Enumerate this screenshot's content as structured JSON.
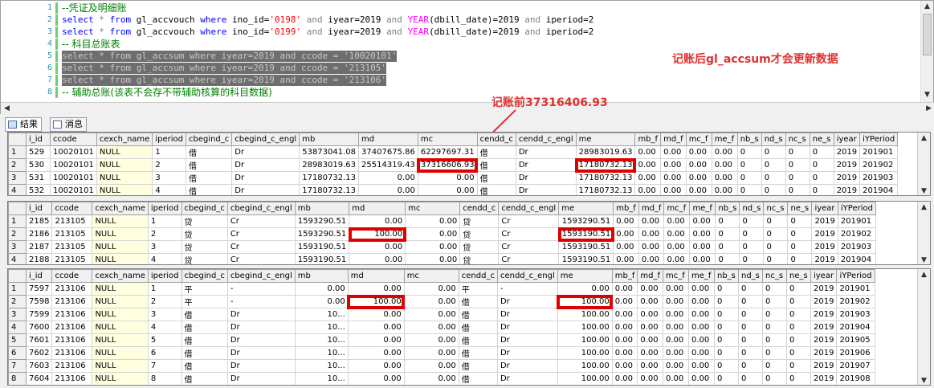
{
  "editor": {
    "lines": [
      {
        "n": "1",
        "parts": [
          {
            "t": "--凭证及明细账",
            "c": "cmt"
          }
        ]
      },
      {
        "n": "2",
        "parts": [
          {
            "t": "select",
            "c": "kw"
          },
          {
            "t": " * ",
            "c": "gray"
          },
          {
            "t": "from",
            "c": "kw"
          },
          {
            "t": " gl_accvouch ",
            "c": ""
          },
          {
            "t": "where",
            "c": "kw"
          },
          {
            "t": " ino_id=",
            "c": ""
          },
          {
            "t": "'0198'",
            "c": "str"
          },
          {
            "t": " and ",
            "c": "gray"
          },
          {
            "t": "iyear=2019 ",
            "c": ""
          },
          {
            "t": "and",
            "c": "gray"
          },
          {
            "t": " ",
            "c": ""
          },
          {
            "t": "YEAR",
            "c": "fn"
          },
          {
            "t": "(dbill_date)=2019 ",
            "c": ""
          },
          {
            "t": "and",
            "c": "gray"
          },
          {
            "t": " iperiod=2",
            "c": ""
          }
        ]
      },
      {
        "n": "3",
        "parts": [
          {
            "t": "select",
            "c": "kw"
          },
          {
            "t": " * ",
            "c": "gray"
          },
          {
            "t": "from",
            "c": "kw"
          },
          {
            "t": " gl_accvouch ",
            "c": ""
          },
          {
            "t": "where",
            "c": "kw"
          },
          {
            "t": " ino_id=",
            "c": ""
          },
          {
            "t": "'0199'",
            "c": "str"
          },
          {
            "t": " and ",
            "c": "gray"
          },
          {
            "t": "iyear=2019 ",
            "c": ""
          },
          {
            "t": "and",
            "c": "gray"
          },
          {
            "t": " ",
            "c": ""
          },
          {
            "t": "YEAR",
            "c": "fn"
          },
          {
            "t": "(dbill_date)=2019 ",
            "c": ""
          },
          {
            "t": "and",
            "c": "gray"
          },
          {
            "t": " iperiod=2",
            "c": ""
          }
        ]
      },
      {
        "n": "4",
        "parts": [
          {
            "t": "-- 科目总账表",
            "c": "cmt"
          }
        ]
      },
      {
        "n": "5",
        "sel": true,
        "parts": [
          {
            "t": "select * from gl_accsum where iyear=2019 and ccode = ",
            "c": ""
          },
          {
            "t": "'10020101'",
            "c": "str"
          }
        ]
      },
      {
        "n": "6",
        "sel": true,
        "parts": [
          {
            "t": "select * from gl_accsum where iyear=2019 and ccode = ",
            "c": ""
          },
          {
            "t": "'213105'",
            "c": "str"
          }
        ]
      },
      {
        "n": "7",
        "sel": true,
        "parts": [
          {
            "t": "select * from gl_accsum where iyear=2019 and ccode = ",
            "c": ""
          },
          {
            "t": "'213106'",
            "c": "str"
          }
        ]
      },
      {
        "n": "8",
        "parts": [
          {
            "t": "-- 辅助总账(该表不会存不带辅助核算的科目数据)",
            "c": "cmt"
          }
        ]
      }
    ]
  },
  "annotations": {
    "note_after": "记账后gl_accsum才会更新数据",
    "note_before": "记账前37316406.93"
  },
  "tabs": {
    "results": "结果",
    "messages": "消息"
  },
  "grid1": {
    "columns": [
      "",
      "i_id",
      "ccode",
      "cexch_name",
      "iperiod",
      "cbegind_c",
      "cbegind_c_engl",
      "mb",
      "md",
      "mc",
      "cendd_c",
      "cendd_c_engl",
      "me",
      "mb_f",
      "md_f",
      "mc_f",
      "me_f",
      "nb_s",
      "nd_s",
      "nc_s",
      "ne_s",
      "iyear",
      "iYPeriod"
    ],
    "rows": [
      [
        "1",
        "529",
        "10020101",
        "NULL",
        "1",
        "借",
        "Dr",
        "53873041.08",
        "37407675.86",
        "62297697.31",
        "借",
        "Dr",
        "28983019.63",
        "0.00",
        "0.00",
        "0.00",
        "0.00",
        "0",
        "0",
        "0",
        "0",
        "2019",
        "201901"
      ],
      [
        "2",
        "530",
        "10020101",
        "NULL",
        "2",
        "借",
        "Dr",
        "28983019.63",
        "25514319.43",
        "37316606.93",
        "借",
        "Dr",
        "17180732.13",
        "0.00",
        "0.00",
        "0.00",
        "0.00",
        "0",
        "0",
        "0",
        "0",
        "2019",
        "201902"
      ],
      [
        "3",
        "531",
        "10020101",
        "NULL",
        "3",
        "借",
        "Dr",
        "17180732.13",
        "0.00",
        "0.00",
        "借",
        "Dr",
        "17180732.13",
        "0.00",
        "0.00",
        "0.00",
        "0.00",
        "0",
        "0",
        "0",
        "0",
        "2019",
        "201903"
      ],
      [
        "4",
        "532",
        "10020101",
        "NULL",
        "4",
        "借",
        "Dr",
        "17180732.13",
        "0.00",
        "0.00",
        "借",
        "Dr",
        "17180732.13",
        "0.00",
        "0.00",
        "0.00",
        "0.00",
        "0",
        "0",
        "0",
        "0",
        "2019",
        "201904"
      ]
    ]
  },
  "grid2": {
    "columns": [
      "",
      "i_id",
      "ccode",
      "cexch_name",
      "iperiod",
      "cbegind_c",
      "cbegind_c_engl",
      "mb",
      "md",
      "mc",
      "cendd_c",
      "cendd_c_engl",
      "me",
      "mb_f",
      "md_f",
      "mc_f",
      "me_f",
      "nb_s",
      "nd_s",
      "nc_s",
      "ne_s",
      "iyear",
      "iYPeriod"
    ],
    "rows": [
      [
        "1",
        "2185",
        "213105",
        "NULL",
        "1",
        "贷",
        "Cr",
        "1593290.51",
        "0.00",
        "0.00",
        "贷",
        "Cr",
        "1593290.51",
        "0.00",
        "0.00",
        "0.00",
        "0.00",
        "0",
        "0",
        "0",
        "0",
        "2019",
        "201901"
      ],
      [
        "2",
        "2186",
        "213105",
        "NULL",
        "2",
        "贷",
        "Cr",
        "1593290.51",
        "100.00",
        "0.00",
        "贷",
        "Cr",
        "1593190.51",
        "0.00",
        "0.00",
        "0.00",
        "0.00",
        "0",
        "0",
        "0",
        "0",
        "2019",
        "201902"
      ],
      [
        "3",
        "2187",
        "213105",
        "NULL",
        "3",
        "贷",
        "Cr",
        "1593190.51",
        "0.00",
        "0.00",
        "贷",
        "Cr",
        "1593190.51",
        "0.00",
        "0.00",
        "0.00",
        "0.00",
        "0",
        "0",
        "0",
        "0",
        "2019",
        "201903"
      ],
      [
        "4",
        "2188",
        "213105",
        "NULL",
        "4",
        "贷",
        "Cr",
        "1593190.51",
        "0.00",
        "0.00",
        "贷",
        "Cr",
        "1593190.51",
        "0.00",
        "0.00",
        "0.00",
        "0.00",
        "0",
        "0",
        "0",
        "0",
        "2019",
        "201904"
      ]
    ]
  },
  "grid3": {
    "columns": [
      "",
      "i_id",
      "ccode",
      "cexch_name",
      "iperiod",
      "cbegind_c",
      "cbegind_c_engl",
      "mb",
      "md",
      "mc",
      "cendd_c",
      "cendd_c_engl",
      "me",
      "mb_f",
      "md_f",
      "mc_f",
      "me_f",
      "nb_s",
      "nd_s",
      "nc_s",
      "ne_s",
      "iyear",
      "iYPeriod"
    ],
    "rows": [
      [
        "1",
        "7597",
        "213106",
        "NULL",
        "1",
        "平",
        "-",
        "0.00",
        "0.00",
        "0.00",
        "平",
        "-",
        "0.00",
        "0.00",
        "0.00",
        "0.00",
        "0.00",
        "0",
        "0",
        "0",
        "0",
        "2019",
        "201901"
      ],
      [
        "2",
        "7598",
        "213106",
        "NULL",
        "2",
        "平",
        "-",
        "0.00",
        "100.00",
        "0.00",
        "借",
        "Dr",
        "100.00",
        "0.00",
        "0.00",
        "0.00",
        "0.00",
        "0",
        "0",
        "0",
        "0",
        "2019",
        "201902"
      ],
      [
        "3",
        "7599",
        "213106",
        "NULL",
        "3",
        "借",
        "Dr",
        "10...",
        "0.00",
        "0.00",
        "借",
        "Dr",
        "100.00",
        "0.00",
        "0.00",
        "0.00",
        "0.00",
        "0",
        "0",
        "0",
        "0",
        "2019",
        "201903"
      ],
      [
        "4",
        "7600",
        "213106",
        "NULL",
        "4",
        "借",
        "Dr",
        "10...",
        "0.00",
        "0.00",
        "借",
        "Dr",
        "100.00",
        "0.00",
        "0.00",
        "0.00",
        "0.00",
        "0",
        "0",
        "0",
        "0",
        "2019",
        "201904"
      ],
      [
        "5",
        "7601",
        "213106",
        "NULL",
        "5",
        "借",
        "Dr",
        "10...",
        "0.00",
        "0.00",
        "借",
        "Dr",
        "100.00",
        "0.00",
        "0.00",
        "0.00",
        "0.00",
        "0",
        "0",
        "0",
        "0",
        "2019",
        "201905"
      ],
      [
        "6",
        "7602",
        "213106",
        "NULL",
        "6",
        "借",
        "Dr",
        "10...",
        "0.00",
        "0.00",
        "借",
        "Dr",
        "100.00",
        "0.00",
        "0.00",
        "0.00",
        "0.00",
        "0",
        "0",
        "0",
        "0",
        "2019",
        "201906"
      ],
      [
        "7",
        "7603",
        "213106",
        "NULL",
        "7",
        "借",
        "Dr",
        "10...",
        "0.00",
        "0.00",
        "借",
        "Dr",
        "100.00",
        "0.00",
        "0.00",
        "0.00",
        "0.00",
        "0",
        "0",
        "0",
        "0",
        "2019",
        "201907"
      ],
      [
        "8",
        "7604",
        "213106",
        "NULL",
        "8",
        "借",
        "Dr",
        "10...",
        "0.00",
        "0.00",
        "借",
        "Dr",
        "100.00",
        "0.00",
        "0.00",
        "0.00",
        "0.00",
        "0",
        "0",
        "0",
        "0",
        "2019",
        "201908"
      ]
    ]
  },
  "highlight_color": "#e00000"
}
